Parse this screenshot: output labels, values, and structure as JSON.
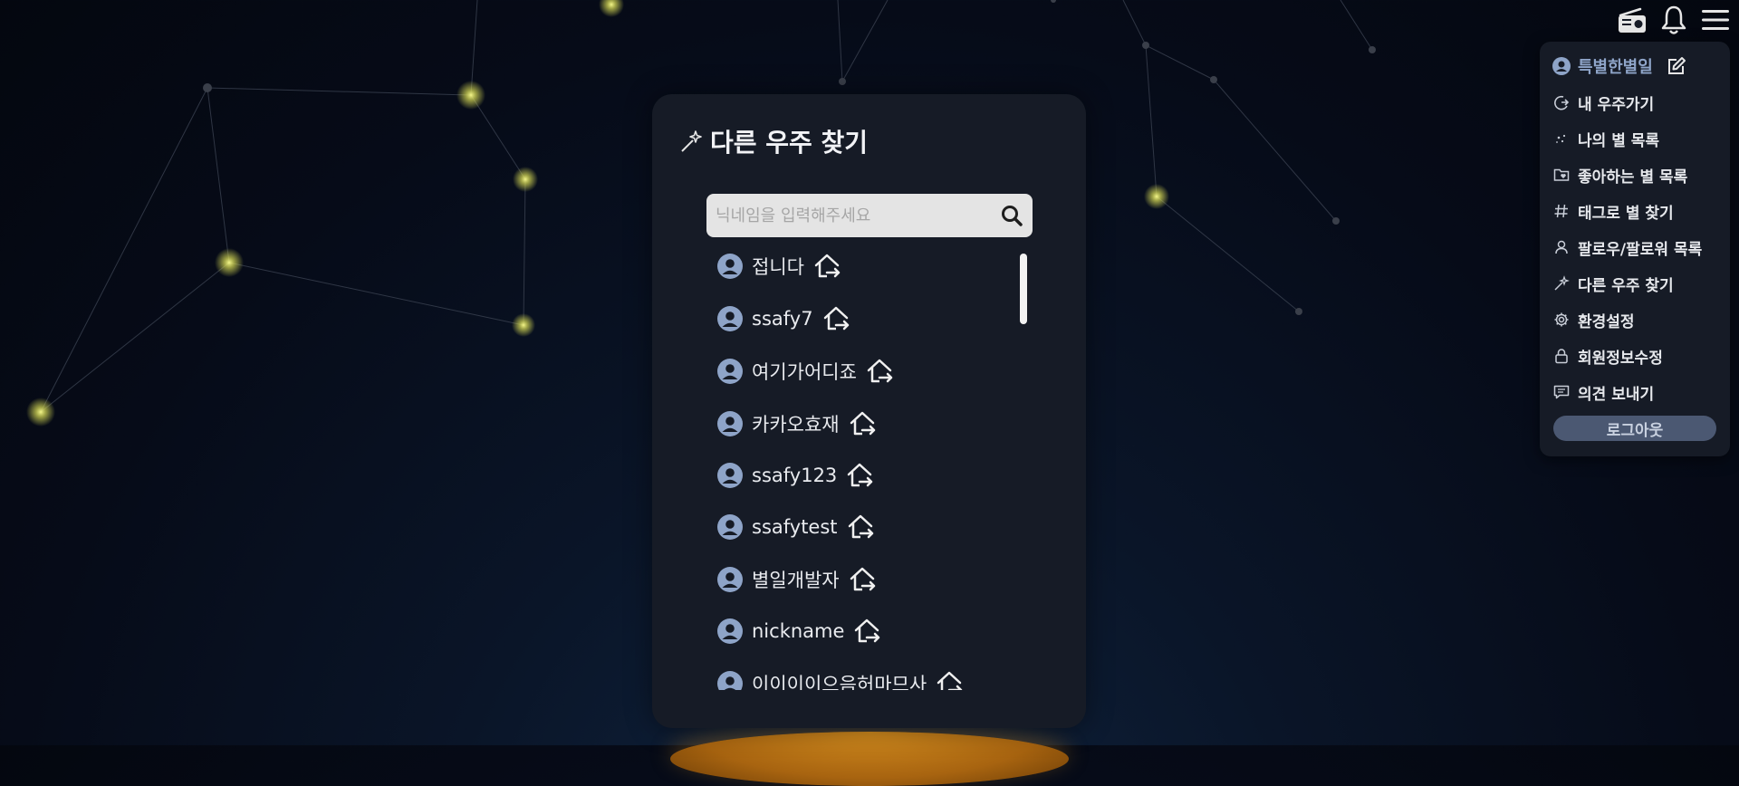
{
  "panel": {
    "title": "다른 우주 찾기",
    "title_icon": "wand-sparkles-icon",
    "search": {
      "placeholder": "닉네임을 입력해주세요",
      "value": "",
      "icon": "search-icon"
    },
    "users": [
      {
        "name": "접니다"
      },
      {
        "name": "ssafy7"
      },
      {
        "name": "여기가어디죠"
      },
      {
        "name": "카카오효재"
      },
      {
        "name": "ssafy123"
      },
      {
        "name": "ssafytest"
      },
      {
        "name": "별일개발자"
      },
      {
        "name": "nickname"
      },
      {
        "name": "이이이이으음허마므사"
      }
    ]
  },
  "top_icons": [
    "radio-icon",
    "bell-icon",
    "hamburger-menu-icon"
  ],
  "menu": {
    "username": "특별한별일",
    "items": [
      {
        "label": "내 우주가기",
        "icon": "moon-arrow-icon"
      },
      {
        "label": "나의 별 목록",
        "icon": "sparkle-dots-icon"
      },
      {
        "label": "좋아하는 별 목록",
        "icon": "folder-heart-icon"
      },
      {
        "label": "태그로 별 찾기",
        "icon": "hash-icon"
      },
      {
        "label": "팔로우/팔로워 목록",
        "icon": "user-icon"
      },
      {
        "label": "다른 우주 찾기",
        "icon": "wand-sparkles-icon"
      },
      {
        "label": "환경설정",
        "icon": "gear-icon"
      },
      {
        "label": "회원정보수정",
        "icon": "lock-icon"
      },
      {
        "label": "의견 보내기",
        "icon": "message-icon"
      }
    ],
    "logout": "로그아웃"
  },
  "colors": {
    "background": "#060b18",
    "panel": "#161b26",
    "accent": "#8ea4c8",
    "star": "#e0e36a",
    "planet": "#c07a18"
  }
}
